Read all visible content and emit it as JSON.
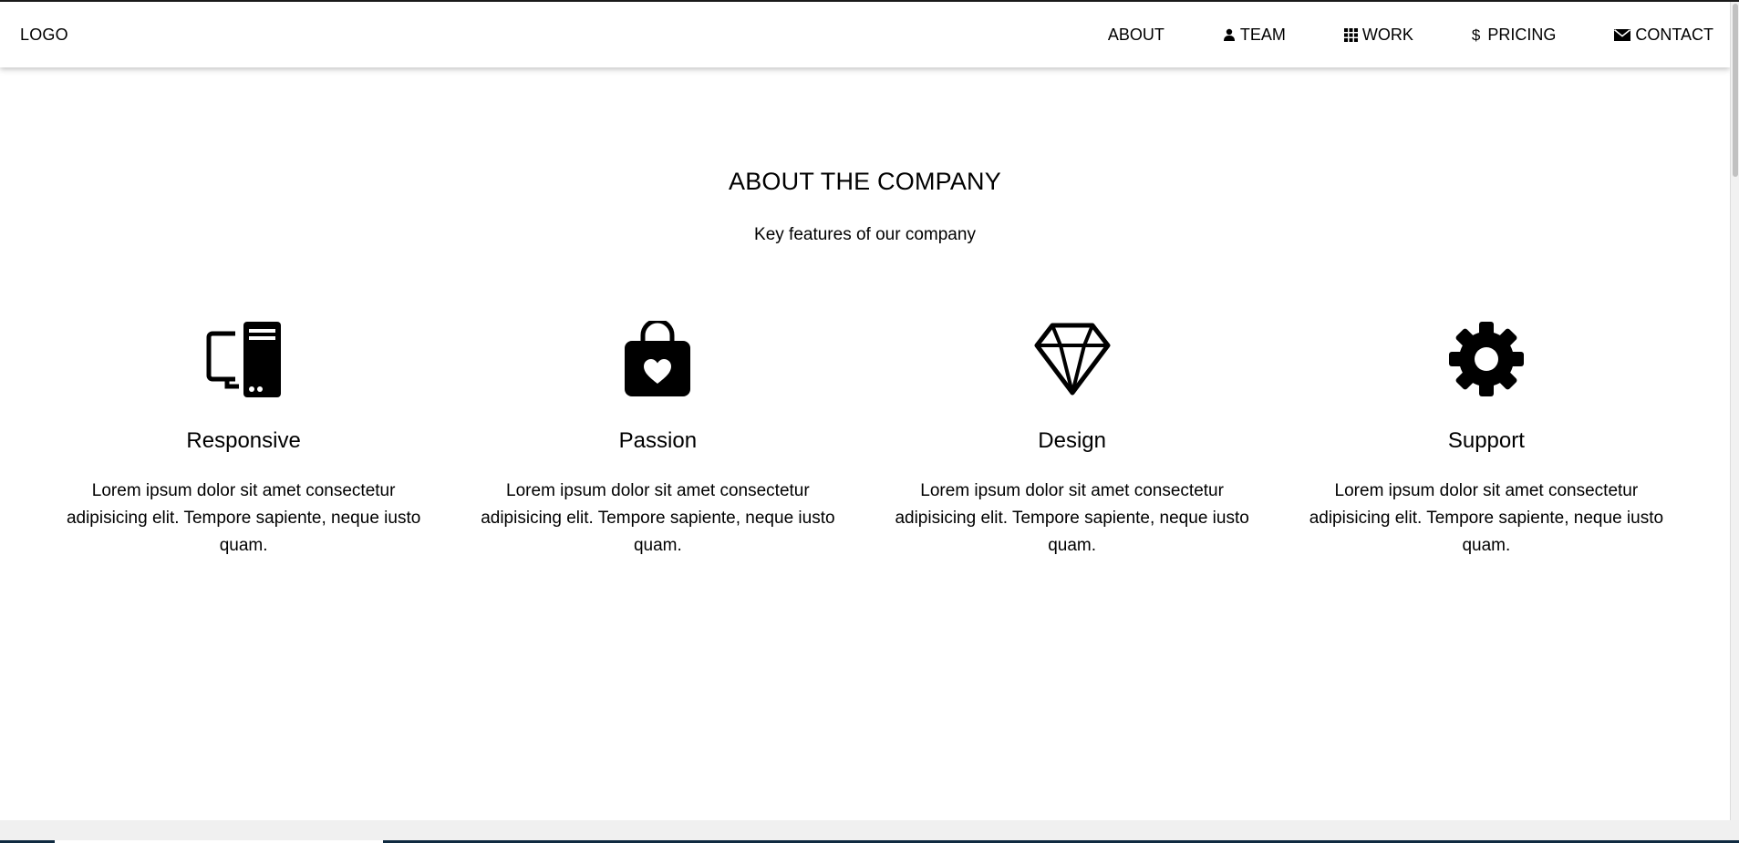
{
  "nav": {
    "logo": "LOGO",
    "items": [
      {
        "label": "ABOUT",
        "icon": "none"
      },
      {
        "label": "TEAM",
        "icon": "user-icon"
      },
      {
        "label": "WORK",
        "icon": "grid-icon"
      },
      {
        "label": "PRICING",
        "icon": "dollar-icon",
        "glyph": "$"
      },
      {
        "label": "CONTACT",
        "icon": "envelope-icon"
      }
    ]
  },
  "about": {
    "title": "ABOUT THE COMPANY",
    "subtitle": "Key features of our company",
    "features": [
      {
        "title": "Responsive",
        "icon": "desktop-icon",
        "text": "Lorem ipsum dolor sit amet consectetur adipisicing elit. Tempore sapiente, neque iusto quam."
      },
      {
        "title": "Passion",
        "icon": "shopping-bag-heart-icon",
        "text": "Lorem ipsum dolor sit amet consectetur adipisicing elit. Tempore sapiente, neque iusto quam."
      },
      {
        "title": "Design",
        "icon": "diamond-icon",
        "text": "Lorem ipsum dolor sit amet consectetur adipisicing elit. Tempore sapiente, neque iusto quam."
      },
      {
        "title": "Support",
        "icon": "gear-icon",
        "text": "Lorem ipsum dolor sit amet consectetur adipisicing elit. Tempore sapiente, neque iusto quam."
      }
    ]
  },
  "colors": {
    "text": "#000000",
    "background": "#ffffff",
    "footer_strip": "#f0f0f0"
  }
}
